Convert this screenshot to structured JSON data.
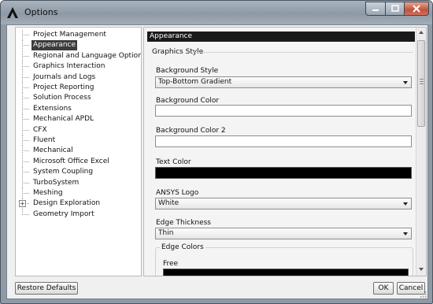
{
  "window": {
    "title": "Options",
    "app_icon": "ansys-logo-icon",
    "controls": {
      "minimize": "minimize-icon",
      "maximize": "maximize-icon",
      "close": "close-icon"
    }
  },
  "tree": {
    "items": [
      {
        "label": "Project Management",
        "selected": false
      },
      {
        "label": "Appearance",
        "selected": true
      },
      {
        "label": "Regional and Language Options",
        "selected": false
      },
      {
        "label": "Graphics Interaction",
        "selected": false
      },
      {
        "label": "Journals and Logs",
        "selected": false
      },
      {
        "label": "Project Reporting",
        "selected": false
      },
      {
        "label": "Solution Process",
        "selected": false
      },
      {
        "label": "Extensions",
        "selected": false
      },
      {
        "label": "Mechanical APDL",
        "selected": false
      },
      {
        "label": "CFX",
        "selected": false
      },
      {
        "label": "Fluent",
        "selected": false
      },
      {
        "label": "Mechanical",
        "selected": false
      },
      {
        "label": "Microsoft Office Excel",
        "selected": false
      },
      {
        "label": "System Coupling",
        "selected": false
      },
      {
        "label": "TurboSystem",
        "selected": false
      },
      {
        "label": "Meshing",
        "selected": false
      },
      {
        "label": "Design Exploration",
        "selected": false,
        "expander": "+"
      },
      {
        "label": "Geometry Import",
        "selected": false
      }
    ]
  },
  "panel": {
    "header": "Appearance",
    "group_title": "Graphics Style",
    "background_style": {
      "label": "Background Style",
      "value": "Top-Bottom Gradient"
    },
    "background_color": {
      "label": "Background Color",
      "color": "#ffffff"
    },
    "background_color2": {
      "label": "Background Color 2",
      "color": "#ffffff"
    },
    "text_color": {
      "label": "Text Color",
      "color": "#000000"
    },
    "ansys_logo": {
      "label": "ANSYS Logo",
      "value": "White"
    },
    "edge_thickness": {
      "label": "Edge Thickness",
      "value": "Thin"
    },
    "edge_colors": {
      "title": "Edge Colors",
      "free_label": "Free",
      "free_color": "#000000"
    }
  },
  "buttons": {
    "restore_defaults": "Restore Defaults",
    "ok": "OK",
    "cancel": "Cancel"
  }
}
